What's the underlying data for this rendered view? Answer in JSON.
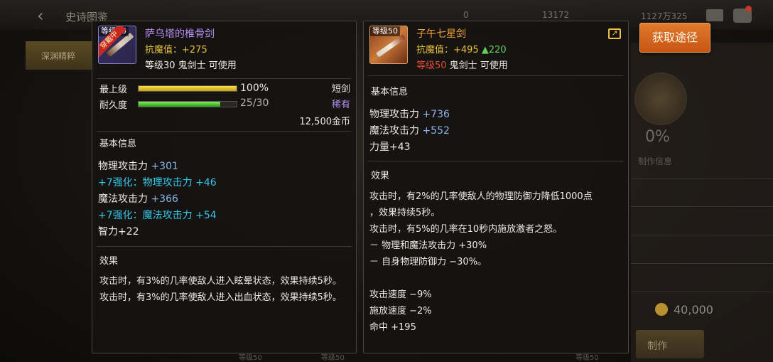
{
  "background": {
    "title": "史诗图鉴",
    "side_tab": "深渊精粹",
    "resources": [
      "0",
      "13172",
      "1127万325"
    ],
    "progress_pct": "0%",
    "make_info": "制作信息",
    "cost": "40,000",
    "craft_button": "制作",
    "bottom_tags": [
      "等级50",
      "等级50",
      "等级50"
    ]
  },
  "acquire_button": "获取途径",
  "left_item": {
    "level_tag": "等级30",
    "equipped": "穿戴中",
    "name": "萨乌塔的椎骨剑",
    "resist_label": "抗魔值：",
    "resist_value": "+275",
    "requirement": "等级30 鬼剑士 可使用",
    "max_level_label": "最上级",
    "max_level_value": "100%",
    "max_level_fill": 1.0,
    "durability_label": "耐久度",
    "durability_value": "25/30",
    "durability_fill": 0.833,
    "weapon_type": "短剑",
    "rarity": "稀有",
    "price": "12,500金币",
    "basic_title": "基本信息",
    "stats": [
      {
        "label": "物理攻击力 ",
        "value": "+301"
      },
      {
        "label": "+7强化：物理攻击力 +46",
        "value": ""
      },
      {
        "label": "魔法攻击力 ",
        "value": "+366"
      },
      {
        "label": "+7强化：魔法攻击力 +54",
        "value": ""
      },
      {
        "label": "智力+22",
        "value": ""
      }
    ],
    "effect_title": "效果",
    "effect_lines": [
      "攻击时，有3%的几率使敌人进入眩晕状态，效果持续5秒。",
      "攻击时，有3%的几率使敌人进入出血状态，效果持续5秒。"
    ]
  },
  "right_item": {
    "level_tag": "等级50",
    "name": "子午七星剑",
    "resist_label": "抗魔值：",
    "resist_value": "+495",
    "resist_delta": "▲220",
    "requirement_level": "等级50",
    "requirement_rest": " 鬼剑士 可使用",
    "basic_title": "基本信息",
    "stats": [
      {
        "label": "物理攻击力 ",
        "value": "+736"
      },
      {
        "label": "魔法攻击力 ",
        "value": "+552"
      },
      {
        "label": "力量+43",
        "value": ""
      }
    ],
    "effect_title": "效果",
    "effect_lines": [
      "攻击时，有2%的几率使敌人的物理防御力降低1000点",
      "，效果持续5秒。",
      "攻击时，有5%的几率在10秒内施放激者之怒。",
      " － 物理和魔法攻击力 +30%",
      " － 自身物理防御力 −30%。",
      "",
      "攻击速度 −9%",
      "施放速度 −2%",
      "命中 +195"
    ]
  }
}
